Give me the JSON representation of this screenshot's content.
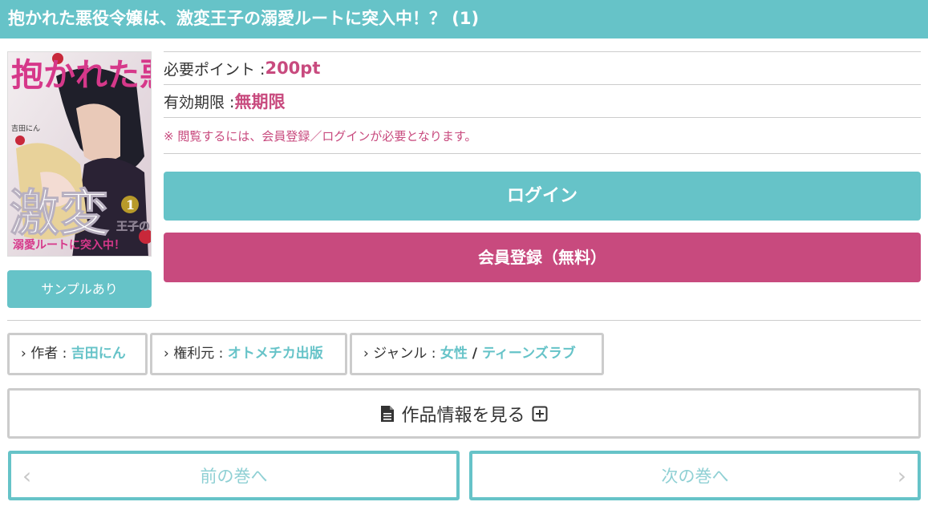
{
  "header": {
    "title": "抱かれた悪役令嬢は、激変王子の溺愛ルートに突入中！？ (1)"
  },
  "cover": {
    "title_line1": "抱かれた悪役令嬢は、",
    "title_big": "激変",
    "title_prince": "王子の",
    "title_sub": "溺愛ルートに突入中！",
    "author": "吉田にん",
    "volume": "1"
  },
  "sample_button": {
    "label": "サンプルあり"
  },
  "purchase": {
    "points_label": "必要ポイント : ",
    "points_value": "200pt",
    "expire_label": "有効期限 : ",
    "expire_value": "無期限",
    "note": "※ 閲覧するには、会員登録／ログインが必要となります。"
  },
  "buttons": {
    "login": "ログイン",
    "register": "会員登録（無料）"
  },
  "meta": {
    "author_label": "› 作者 : ",
    "author_value": "吉田にん",
    "rights_label": "› 権利元 : ",
    "rights_value": "オトメチカ出版",
    "genre_label": "› ジャンル : ",
    "genre_value1": "女性",
    "genre_sep": " / ",
    "genre_value2": "ティーンズラブ"
  },
  "work_info": {
    "label": "作品情報を見る"
  },
  "navigation": {
    "prev": "前の巻へ",
    "next": "次の巻へ"
  },
  "colors": {
    "teal": "#66c3c8",
    "pink": "#c84a7e",
    "border_gray": "#cccccc"
  },
  "icons": [
    "document-icon",
    "plus-square-icon",
    "chevron-left-icon",
    "chevron-right-icon"
  ]
}
